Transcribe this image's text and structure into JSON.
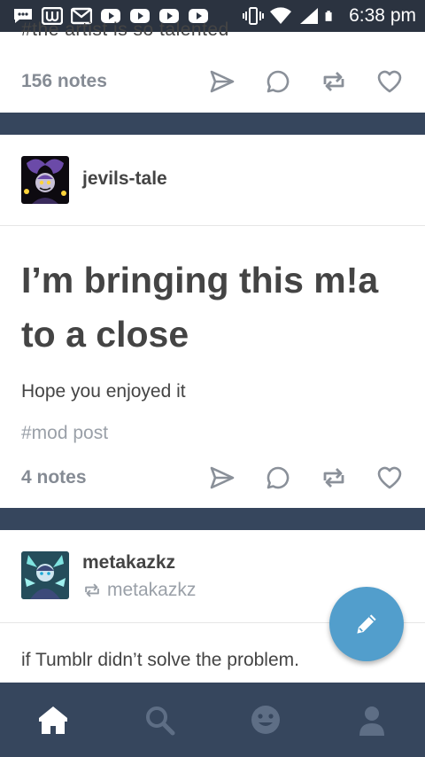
{
  "status_bar": {
    "time": "6:38 pm",
    "icons": [
      "chat-icon",
      "unread-icon",
      "gmail-icon",
      "youtube-icon",
      "youtube-icon",
      "youtube-icon",
      "youtube-icon",
      "vibrate-icon",
      "wifi-icon",
      "signal-icon",
      "battery-icon"
    ]
  },
  "posts": [
    {
      "cut_text": "#the artist is so talented",
      "notes": "156 notes"
    },
    {
      "blog": "jevils-tale",
      "title": "I’m bringing this m!a to a close",
      "body": "Hope you enjoyed it",
      "tag": "#mod post",
      "notes": "4 notes"
    },
    {
      "blog": "metakazkz",
      "reblogged_from": "metakazkz",
      "body": "if Tumblr didn’t solve the problem."
    }
  ],
  "actions": [
    "share-icon",
    "reply-icon",
    "reblog-icon",
    "like-icon"
  ],
  "nav": [
    "home-icon",
    "search-icon",
    "activity-icon",
    "account-icon"
  ],
  "colors": {
    "dashboard_bg": "#36465d",
    "text": "#444444",
    "muted": "#858b94",
    "accent": "#529ecc"
  }
}
